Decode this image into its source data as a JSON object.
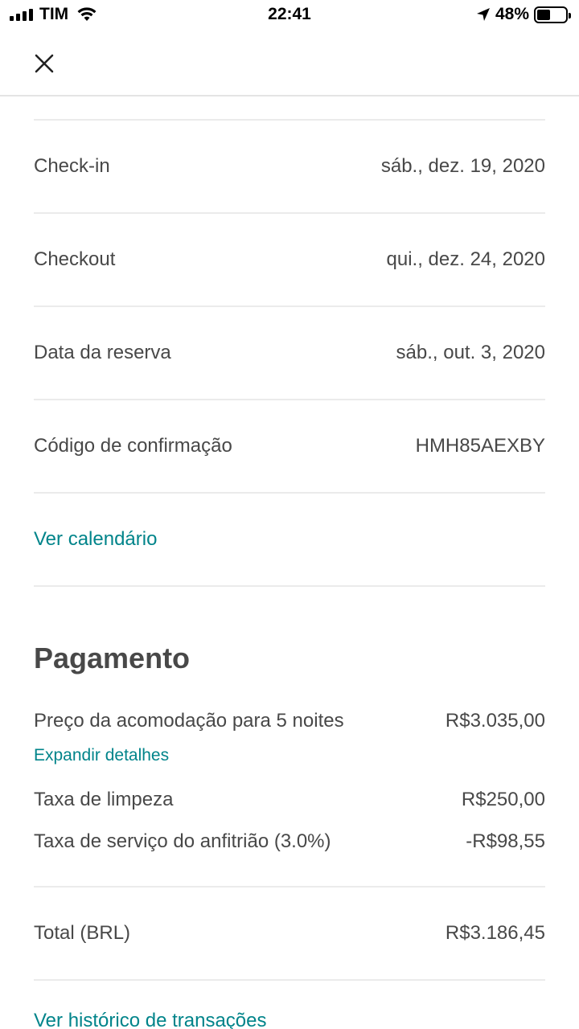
{
  "status_bar": {
    "carrier": "TIM",
    "time": "22:41",
    "battery_percent": "48%",
    "battery_level": 0.48,
    "icons": [
      "signal-icon",
      "wifi-icon",
      "location-arrow-icon",
      "battery-icon"
    ]
  },
  "nav": {
    "close_icon": "close-icon"
  },
  "details": [
    {
      "label": "Check-in",
      "value": "sáb., dez. 19, 2020"
    },
    {
      "label": "Checkout",
      "value": "qui., dez. 24, 2020"
    },
    {
      "label": "Data da reserva",
      "value": "sáb., out. 3, 2020"
    },
    {
      "label": "Código de confirmação",
      "value": "HMH85AEXBY"
    }
  ],
  "calendar_link": "Ver calendário",
  "payment": {
    "title": "Pagamento",
    "lodging_label": "Preço da acomodação para 5 noites",
    "lodging_value": "R$3.035,00",
    "expand_link": "Expandir detalhes",
    "cleaning_label": "Taxa de limpeza",
    "cleaning_value": "R$250,00",
    "service_label": "Taxa de serviço do anfitrião (3.0%)",
    "service_value": "-R$98,55",
    "total_label": "Total (BRL)",
    "total_value": "R$3.186,45",
    "history_link": "Ver histórico de transações"
  },
  "colors": {
    "accent": "#00848a",
    "text": "#484848",
    "divider": "#ebebeb"
  }
}
